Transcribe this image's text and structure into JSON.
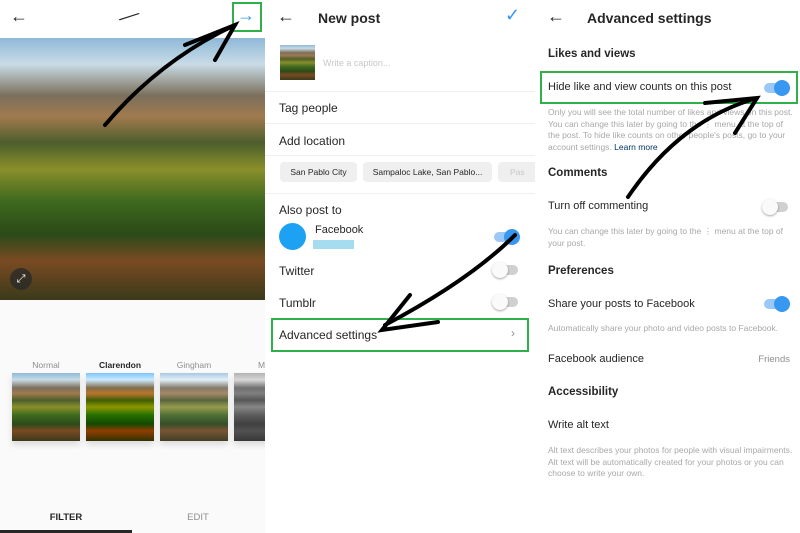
{
  "editor": {
    "filters": [
      {
        "name": "Normal",
        "selected": false
      },
      {
        "name": "Clarendon",
        "selected": true
      },
      {
        "name": "Gingham",
        "selected": false
      },
      {
        "name": "M",
        "selected": false
      }
    ],
    "tabs": {
      "filter": "FILTER",
      "edit": "EDIT",
      "active": "FILTER"
    }
  },
  "new_post": {
    "title": "New post",
    "caption_placeholder": "Write a caption...",
    "tag_people": "Tag people",
    "add_location": "Add location",
    "location_chips": [
      "San Pablo City",
      "Sampaloc Lake, San Pablo...",
      "Pas"
    ],
    "also_post_to": "Also post to",
    "facebook": {
      "label": "Facebook",
      "enabled": true
    },
    "twitter": {
      "label": "Twitter",
      "enabled": false
    },
    "tumblr": {
      "label": "Tumblr",
      "enabled": false
    },
    "advanced_settings": "Advanced settings"
  },
  "advanced": {
    "title": "Advanced settings",
    "likes_section": "Likes and views",
    "hide_likes": {
      "label": "Hide like and view counts on this post",
      "enabled": true
    },
    "hide_likes_desc": "Only you will see the total number of likes and views on this post. You can change this later by going to the ⋮ menu at the top of the post. To hide like counts on other people's posts, go to your account settings.",
    "learn_more": "Learn more",
    "comments_section": "Comments",
    "turn_off_commenting": {
      "label": "Turn off commenting",
      "enabled": false
    },
    "commenting_desc": "You can change this later by going to the ⋮ menu at the top of your post.",
    "preferences_section": "Preferences",
    "share_facebook": {
      "label": "Share your posts to Facebook",
      "enabled": true
    },
    "share_desc": "Automatically share your photo and video posts to Facebook.",
    "facebook_audience": {
      "label": "Facebook audience",
      "value": "Friends"
    },
    "accessibility_section": "Accessibility",
    "alt_text": "Write alt text",
    "alt_text_desc": "Alt text describes your photos for people with visual impairments. Alt text will be automatically created for your photos or you can choose to write your own."
  },
  "colors": {
    "accent": "#3897f0",
    "highlight_box": "#2fb04a",
    "facebook": "#1da1f2"
  }
}
